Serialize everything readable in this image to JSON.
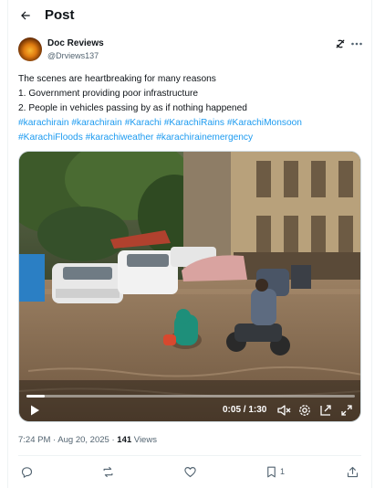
{
  "header": {
    "title": "Post",
    "back_icon": "arrow-left-icon"
  },
  "author": {
    "display_name": "Doc Reviews",
    "handle": "@Drviews137",
    "avatar": "avatar-image"
  },
  "tweet": {
    "lines": [
      "The scenes are heartbreaking for many reasons",
      "1. Government providing poor infrastructure",
      "2. People in vehicles passing by as if nothing happened"
    ],
    "hashtags": [
      "#karachirain",
      "#karachirain",
      "#Karachi",
      "#KarachiRains",
      "#KarachiMonsoon",
      "#KarachiFloods",
      "#karachiweather",
      "#karachirainemergency"
    ]
  },
  "video": {
    "time": "0:05 / 1:30",
    "progress": 0.056,
    "controls": [
      "play-icon",
      "mute-icon",
      "settings-icon",
      "pip-icon",
      "fullscreen-icon"
    ]
  },
  "meta": {
    "timestamp": "7:24 PM · Aug 20, 2025",
    "separator": "·",
    "views_count": "141",
    "views_label": "Views"
  },
  "actions": {
    "reply": {
      "icon": "reply-icon",
      "count": ""
    },
    "repost": {
      "icon": "repost-icon",
      "count": ""
    },
    "like": {
      "icon": "heart-icon",
      "count": ""
    },
    "bookmark": {
      "icon": "bookmark-icon",
      "count": "1"
    },
    "share": {
      "icon": "share-icon",
      "count": ""
    }
  },
  "colors": {
    "link": "#1d9bf0",
    "text": "#0f1419",
    "secondary": "#536471",
    "border": "#eff3f4"
  }
}
